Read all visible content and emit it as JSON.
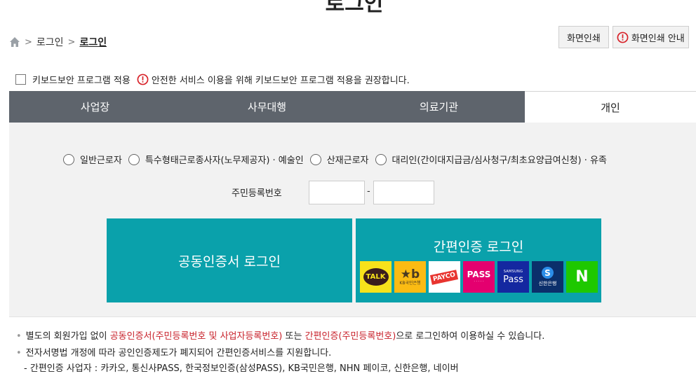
{
  "page": {
    "title": "로그인"
  },
  "breadcrumb": {
    "items": [
      "로그인",
      "로그인"
    ]
  },
  "print_buttons": {
    "print": "화면인쇄",
    "print_guide": "화면인쇄 안내"
  },
  "keyboard_security": {
    "checkbox_label": "키보드보안 프로그램 적용",
    "notice": "안전한 서비스 이용을 위해 키보드보안 프로그램 적용을 권장합니다."
  },
  "tabs": [
    "사업장",
    "사무대행",
    "의료기관",
    "개인"
  ],
  "active_tab": "개인",
  "user_types": [
    "일반근로자",
    "특수형태근로종사자(노무제공자) · 예술인",
    "산재근로자",
    "대리인(간이대지급금/심사청구/최초요양급여신청) · 유족"
  ],
  "ssn": {
    "label": "주민등록번호",
    "separator": "-"
  },
  "login_buttons": {
    "certificate": "공동인증서 로그인",
    "easy_auth": "간편인증 로그인"
  },
  "easy_auth_providers": [
    {
      "name": "kakao-logo",
      "text": "TALK",
      "color": "#f7e21b"
    },
    {
      "name": "kb-logo",
      "text": "KB국민은행",
      "color": "#fbbb13"
    },
    {
      "name": "payco-logo",
      "text": "PAYCO",
      "color": "#e8342f"
    },
    {
      "name": "pass-logo",
      "text": "PASS",
      "color": "#e4006f"
    },
    {
      "name": "samsung-pass-logo",
      "text": "Pass",
      "color": "#1428a0"
    },
    {
      "name": "shinhan-logo",
      "text": "신한은행",
      "color": "#0b2f6b"
    },
    {
      "name": "naver-logo",
      "text": "N",
      "color": "#1ec800"
    }
  ],
  "notices": {
    "line1": {
      "p1": "별도의 회원가입 없이 ",
      "r1": "공동인증서(주민등록번호 및 사업자등록번호)",
      "p2": " 또는 ",
      "r2": "간편인증(주민등록번호)",
      "p3": "으로 로그인하여 이용하실 수 있습니다."
    },
    "line2": "전자서명법 개정에 따라 공인인증제도가 폐지되어 간편인증서비스를 지원합니다.",
    "line3": "- 간편인증 사업자 : 카카오, 통신사PASS, 한국정보인증(삼성PASS), KB국민은행, NHN 페이코, 신한은행, 네이버"
  }
}
